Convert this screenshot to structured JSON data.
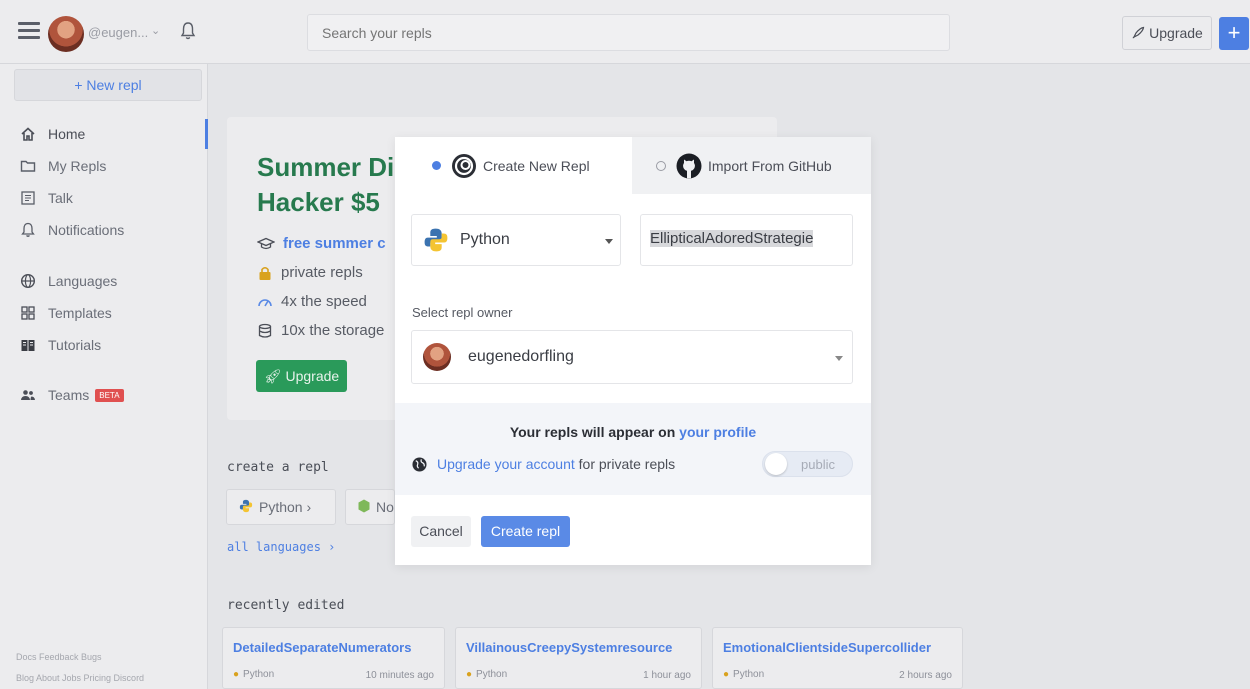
{
  "topbar": {
    "username": "@eugen...",
    "search_placeholder": "Search your repls",
    "upgrade_label": "Upgrade",
    "plus_label": "+"
  },
  "sidebar": {
    "new_repl_label": "+ New repl",
    "items": [
      {
        "label": "Home",
        "icon": "home-icon"
      },
      {
        "label": "My Repls",
        "icon": "folder-icon"
      },
      {
        "label": "Talk",
        "icon": "talk-icon"
      },
      {
        "label": "Notifications",
        "icon": "bell-icon"
      },
      {
        "label": "Languages",
        "icon": "globe-icon"
      },
      {
        "label": "Templates",
        "icon": "templates-icon"
      },
      {
        "label": "Tutorials",
        "icon": "book-icon"
      },
      {
        "label": "Teams",
        "icon": "teams-icon",
        "badge": "BETA"
      }
    ],
    "footer_row1": "Docs  Feedback  Bugs",
    "footer_row2": "Blog  About  Jobs  Pricing  Discord"
  },
  "promo": {
    "title_line1": "Summer Di",
    "title_line2": "Hacker $5",
    "perks": [
      "free summer c",
      "private repls",
      "4x the speed",
      "10x the storage"
    ],
    "button_label": "Upgrade"
  },
  "main": {
    "create_label": "create a repl",
    "chips": [
      "Python ›",
      "No"
    ],
    "all_languages": "all languages ›",
    "recent_label": "recently edited",
    "cards": [
      {
        "title": "DetailedSeparateNumerators",
        "lang": "Python",
        "time": "10 minutes ago"
      },
      {
        "title": "VillainousCreepySystemresource",
        "lang": "Python",
        "time": "1 hour ago"
      },
      {
        "title": "EmotionalClientsideSupercollider",
        "lang": "Python",
        "time": "2 hours ago"
      }
    ]
  },
  "modal": {
    "tab_new": "Create New Repl",
    "tab_github": "Import From GitHub",
    "language": "Python",
    "repl_name": "EllipticalAdoredStrategie",
    "owner_label": "Select repl owner",
    "owner": "eugenedorfling",
    "appear_text": "Your repls will appear on ",
    "appear_link": "your profile",
    "upgrade_link": "Upgrade your account",
    "private_text": " for private repls",
    "toggle_label": "public",
    "cancel_label": "Cancel",
    "create_label": "Create repl"
  },
  "colors": {
    "accent": "#4d7fe2",
    "green": "#2a9a5a",
    "beta": "#e05050"
  }
}
